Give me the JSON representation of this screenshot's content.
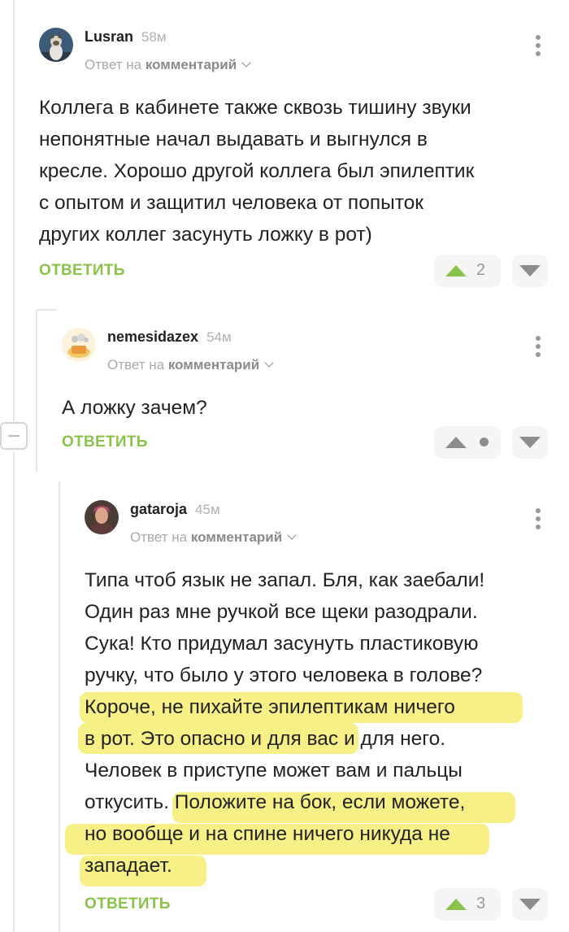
{
  "comments": [
    {
      "username": "Lusran",
      "time": "58м",
      "reply_prefix": "Ответ на",
      "reply_target": "комментарий",
      "lines": [
        "Коллега в кабинете также сквозь тишину звуки",
        "непонятные начал выдавать и выгнулся в",
        "кресле. Хорошо другой коллега был эпилептик",
        "с опытом и защитил человека от попыток",
        "других коллег засунуть ложку в рот)"
      ],
      "reply_label": "ОТВЕТИТЬ",
      "rating": "2",
      "avatar_icon": "cat-avatar"
    },
    {
      "username": "nemesidazex",
      "time": "54м",
      "reply_prefix": "Ответ на",
      "reply_target": "комментарий",
      "lines": [
        "А ложку зачем?"
      ],
      "reply_label": "ОТВЕТИТЬ",
      "rating": "",
      "avatar_icon": "cartoon-avatar"
    },
    {
      "username": "gataroja",
      "time": "45м",
      "reply_prefix": "Ответ на",
      "reply_target": "комментарий",
      "lines": [
        "Типа чтоб язык не запал. Бля, как заебали!",
        "Один раз мне ручкой все щеки разодрали.",
        "Сука! Кто придумал засунуть пластиковую",
        "ручку, что было у этого человека в голове?",
        "Короче, не пихайте эпилептикам ничего",
        "в рот. Это опасно и для вас и для него.",
        "Человек в приступе может вам и пальцы",
        "откусить. Положите на бок, если можете,",
        "но вообще и на спине ничего никуда не",
        "западает."
      ],
      "reply_label": "ОТВЕТИТЬ",
      "rating": "3",
      "avatar_icon": "woman-avatar"
    }
  ],
  "colors": {
    "accent_green": "#8bc34a",
    "highlight_yellow": "#f6f087"
  }
}
